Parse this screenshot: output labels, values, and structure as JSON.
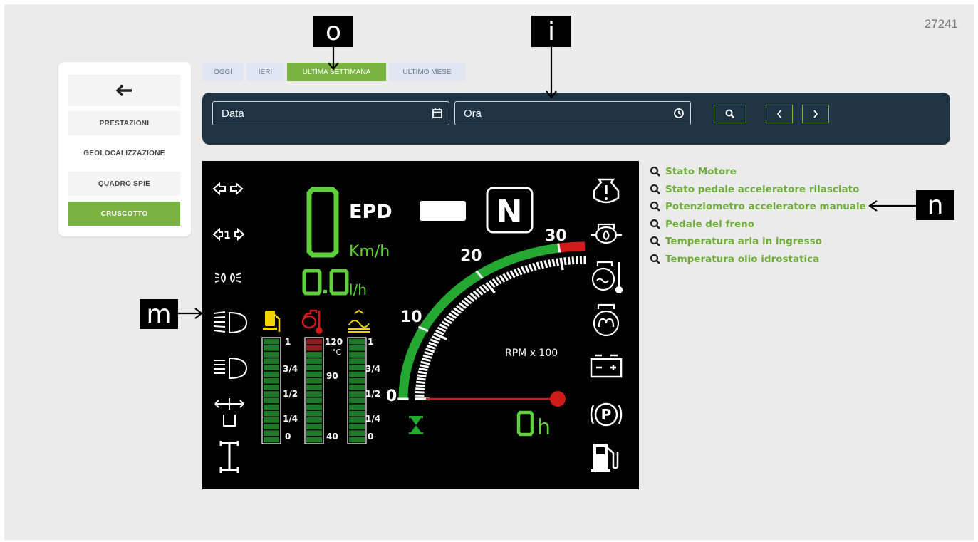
{
  "page_number": "27241",
  "sidebar": {
    "back_icon": "arrow-left-icon",
    "items": [
      {
        "label": "PRESTAZIONI",
        "active": false
      },
      {
        "label": "GEOLOCALIZZAZIONE",
        "active": false
      },
      {
        "label": "QUADRO SPIE",
        "active": false
      },
      {
        "label": "CRUSCOTTO",
        "active": true
      }
    ]
  },
  "tabs": [
    {
      "label": "OGGI",
      "active": false
    },
    {
      "label": "IERI",
      "active": false
    },
    {
      "label": "ULTIMA SETTIMANA",
      "active": true
    },
    {
      "label": "ULTIMO MESE",
      "active": false
    }
  ],
  "toolbar": {
    "date_placeholder": "Data",
    "time_placeholder": "Ora",
    "search_icon": "search-icon",
    "prev_icon": "chevron-left-icon",
    "next_icon": "chevron-right-icon"
  },
  "dashboard": {
    "speed_value": "0",
    "speed_unit": "Km/h",
    "mode_label": "EPD",
    "gear": "N",
    "fuel_rate_value": "0.0",
    "fuel_rate_unit": "l/h",
    "rpm_label": "RPM x 100",
    "rpm_ticks": [
      "0",
      "10",
      "20",
      "30"
    ],
    "rpm_value": 0,
    "hours_value": "0",
    "hours_unit": "h",
    "fuel_gauge_labels": [
      "1",
      "3/4",
      "1/2",
      "1/4",
      "0"
    ],
    "temp_gauge_labels": [
      "120",
      "90",
      "40"
    ],
    "temp_unit": "°C",
    "def_gauge_labels": [
      "1",
      "3/4",
      "1/2",
      "1/4",
      "0"
    ],
    "colors": {
      "green": "#25a832",
      "red": "#d01b1b",
      "yellow": "#f2d500",
      "lcd_green": "#5fcf3c"
    }
  },
  "links": [
    "Stato Motore",
    "Stato pedale acceleratore rilasciato",
    "Potenziometro acceleratore manuale",
    "Pedale del freno",
    "Temperatura aria in ingresso",
    "Temperatura olio idrostatica"
  ],
  "callouts": {
    "o": "o",
    "i": "i",
    "m": "m",
    "n": "n"
  }
}
